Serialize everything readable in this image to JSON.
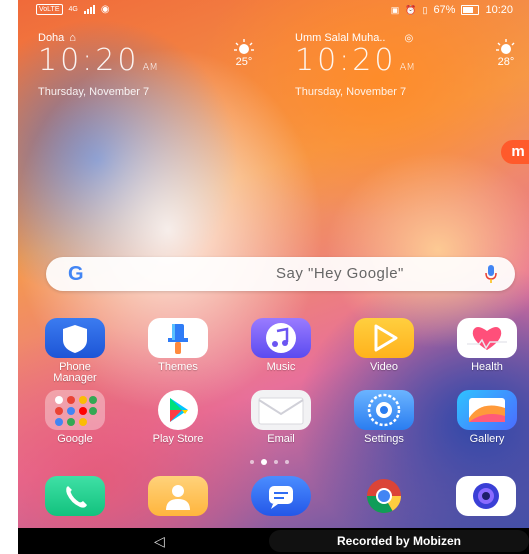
{
  "status_bar": {
    "carrier_chip": "VoLTE",
    "signal_text": "4G",
    "right_text": "67%",
    "time": "10:20"
  },
  "clocks": [
    {
      "city": "Doha",
      "time": "10:20",
      "ampm": "AM",
      "date": "Thursday, November 7",
      "temp": "25°"
    },
    {
      "city": "Umm Salal Muha..",
      "time": "10:20",
      "ampm": "AM",
      "date": "Thursday, November 7",
      "temp": "28°"
    }
  ],
  "search": {
    "logo": "G",
    "placeholder": "Say \"Hey Google\""
  },
  "apps": [
    {
      "label": "Phone Manager",
      "icon": "phone-manager-icon"
    },
    {
      "label": "Themes",
      "icon": "themes-icon"
    },
    {
      "label": "Music",
      "icon": "music-icon"
    },
    {
      "label": "Video",
      "icon": "video-icon"
    },
    {
      "label": "Health",
      "icon": "health-icon"
    },
    {
      "label": "Google",
      "icon": "google-folder-icon"
    },
    {
      "label": "Play Store",
      "icon": "play-store-icon"
    },
    {
      "label": "Email",
      "icon": "email-icon"
    },
    {
      "label": "Settings",
      "icon": "settings-icon"
    },
    {
      "label": "Gallery",
      "icon": "gallery-icon"
    }
  ],
  "dock": [
    {
      "icon": "phone-icon"
    },
    {
      "icon": "contacts-icon"
    },
    {
      "icon": "messages-icon"
    },
    {
      "icon": "chrome-icon"
    },
    {
      "icon": "camera-icon"
    }
  ],
  "page_indicator": {
    "count": 4,
    "active": 1
  },
  "navbar": {
    "back_glyph": "◁"
  },
  "recorder": {
    "text": "Recorded by Mobizen"
  },
  "colors": {
    "toast": "#ff5a2b"
  }
}
